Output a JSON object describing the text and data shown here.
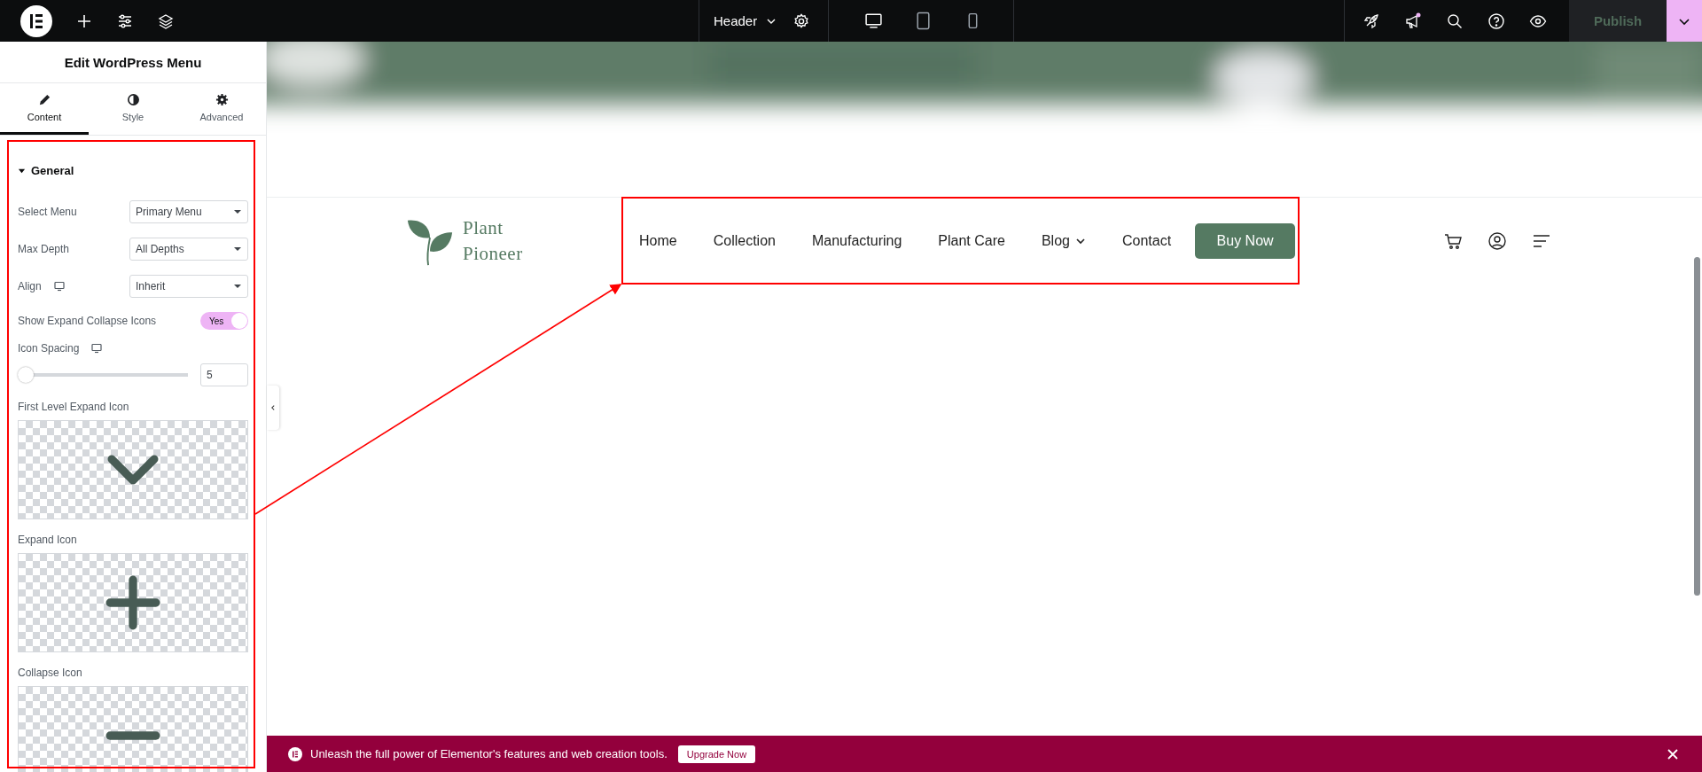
{
  "topbar": {
    "document": "Header",
    "devices": [
      {
        "kind": "desktop",
        "selected": true
      },
      {
        "kind": "tablet",
        "selected": false
      },
      {
        "kind": "mobile",
        "selected": false
      }
    ],
    "publish": {
      "label": "Publish",
      "disabled": true
    }
  },
  "panel": {
    "title": "Edit WordPress Menu",
    "tabs": [
      {
        "label": "Content",
        "selected": true
      },
      {
        "label": "Style",
        "selected": false
      },
      {
        "label": "Advanced",
        "selected": false
      }
    ],
    "section": {
      "title": "General",
      "expanded": true
    },
    "controls": [
      {
        "kind": "select",
        "label": "Select Menu",
        "responsive": false,
        "value": "Primary Menu"
      },
      {
        "kind": "select",
        "label": "Max Depth",
        "responsive": false,
        "value": "All Depths"
      },
      {
        "kind": "select",
        "label": "Align",
        "responsive": true,
        "value": "Inherit"
      },
      {
        "kind": "toggle",
        "label": "Show Expand Collapse Icons",
        "on": true,
        "on_text": "Yes"
      },
      {
        "kind": "slider",
        "label": "Icon Spacing",
        "responsive": true,
        "level": 0,
        "value": "5"
      },
      {
        "kind": "icon_picker",
        "label": "First Level Expand Icon"
      },
      {
        "kind": "icon_picker",
        "label": "Expand Icon"
      },
      {
        "kind": "icon_picker",
        "label": "Collapse Icon"
      }
    ]
  },
  "site_header": {
    "logo_lines": [
      "Plant",
      "Pioneer"
    ],
    "nav": [
      {
        "label": "Home",
        "has_dropdown": false
      },
      {
        "label": "Collection",
        "has_dropdown": false
      },
      {
        "label": "Manufacturing",
        "has_dropdown": false
      },
      {
        "label": "Plant Care",
        "has_dropdown": false
      },
      {
        "label": "Blog",
        "has_dropdown": true
      },
      {
        "label": "Contact",
        "has_dropdown": false
      }
    ],
    "cta": "Buy Now"
  },
  "promo_bar": {
    "text": "Unleash the full power of Elementor's features and web creation tools.",
    "button": "Upgrade Now"
  }
}
